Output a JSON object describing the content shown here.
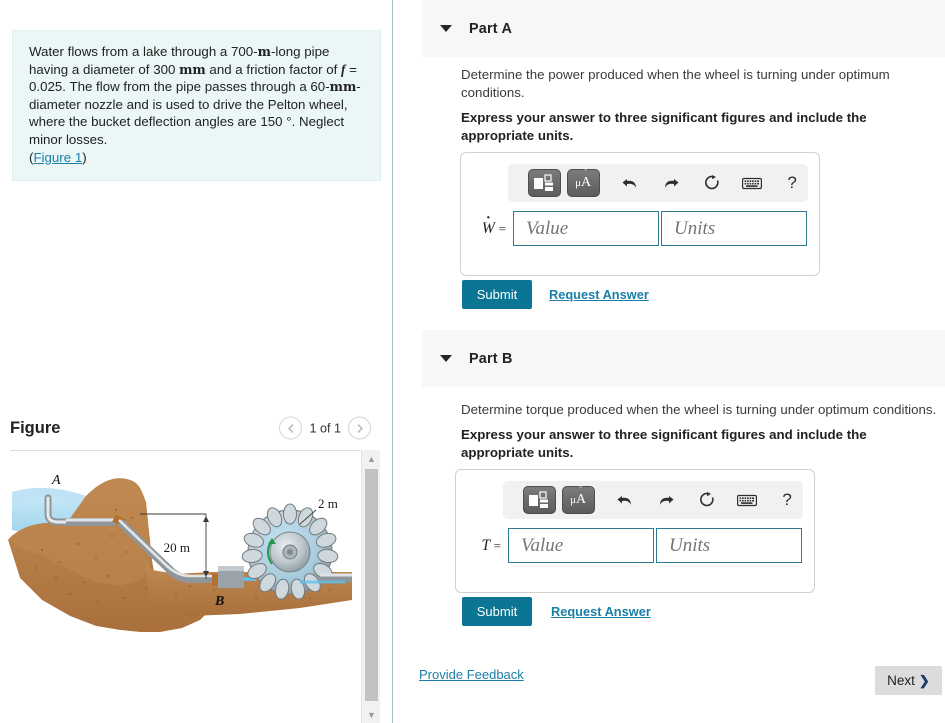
{
  "left": {
    "question": {
      "line1_a": "Water flows from a lake through a 700-",
      "line1_unit": "m",
      "line1_b": "-long pipe having",
      "line2_a": "a diameter of 300 ",
      "line2_unit": "mm",
      "line2_b": " and a friction factor of ",
      "line2_var": "f",
      "line2_c": " = 0.025.",
      "line3_a": "The flow from the pipe passes through a 60-",
      "line3_unit": "mm",
      "line3_b": "-diameter",
      "line4": "nozzle and is used to drive the Pelton wheel, where the",
      "line5": "bucket deflection angles are 150 °. Neglect minor losses.",
      "link": "Figure 1"
    },
    "figure": {
      "title": "Figure",
      "pager_label": "1 of 1",
      "prev_icon": "chevron-left-icon",
      "next_icon": "chevron-right-icon",
      "labels": {
        "point_a": "A",
        "point_b": "B",
        "height": "20 m",
        "wheel_diameter": "2 m"
      }
    }
  },
  "parts": [
    {
      "id": "a",
      "title": "Part A",
      "prompt": "Determine the power produced when the wheel is turning under optimum conditions.",
      "instruction": "Express your answer to three significant figures and include the appropriate units.",
      "variable": "W",
      "equals": "=",
      "value_placeholder": "Value",
      "units_placeholder": "Units",
      "value": "",
      "units": "",
      "submit_label": "Submit",
      "request_label": "Request Answer"
    },
    {
      "id": "b",
      "title": "Part B",
      "prompt": "Determine torque produced when the wheel is turning under optimum conditions.",
      "instruction": "Express your answer to three significant figures and include the appropriate units.",
      "variable": "T",
      "equals": "=",
      "value_placeholder": "Value",
      "units_placeholder": "Units",
      "value": "",
      "units": "",
      "submit_label": "Submit",
      "request_label": "Request Answer"
    }
  ],
  "toolbar": {
    "template_icon": "math-template-icon",
    "units_icon": "units-muA-icon",
    "units_label_mu": "μ",
    "units_label_a": "A",
    "undo_icon": "undo-arrow-icon",
    "redo_icon": "redo-arrow-icon",
    "reset_icon": "reset-circular-arrow-icon",
    "keyboard_icon": "keyboard-icon",
    "help_icon": "question-mark-icon",
    "help_label": "?"
  },
  "footer": {
    "feedback_label": "Provide Feedback",
    "next_label": "Next",
    "next_chevron": "❯"
  },
  "colors": {
    "question_bg": "#eaf7f6",
    "accent_link": "#1a7fa8",
    "submit_bg": "#0b7693",
    "band_bg": "#f7f7f7",
    "input_border": "#2c7b93",
    "next_bg": "#dcdcdc"
  }
}
